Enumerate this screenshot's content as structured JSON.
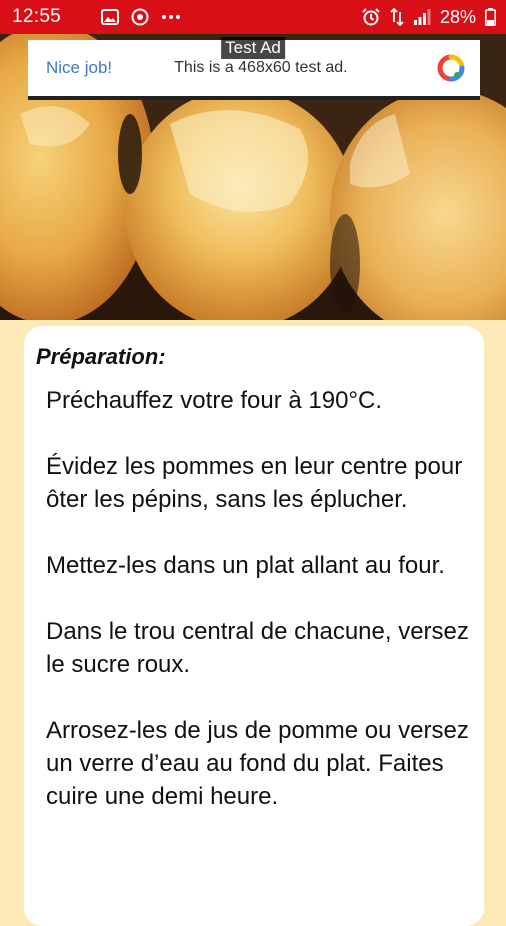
{
  "status_bar": {
    "time": "12:55",
    "battery_text": "28%",
    "background_color": "#d90f17",
    "left_icons": [
      "image-icon",
      "camera-icon",
      "more-dots-icon"
    ],
    "right_icons": [
      "alarm-icon",
      "network-4g-icon",
      "signal-icon",
      "battery-icon"
    ]
  },
  "ad": {
    "label": "Test Ad",
    "nice_text": "Nice job!",
    "body_text": "This is a 468x60 test ad.",
    "logo_icon": "ad-choices-logo-icon"
  },
  "content": {
    "title": "Préparation:",
    "steps": [
      "Préchauffez votre four à 190°C.",
      "Évidez les pommes en leur centre pour ôter les pépins, sans les éplucher.",
      "Mettez-les dans un plat allant au four.",
      "Dans le trou central de chacune, versez le sucre roux.",
      "Arrosez-les de jus de pomme ou versez un verre d’eau au fond du plat. Faites cuire une demi heure."
    ]
  },
  "colors": {
    "page_background": "#fde9b5",
    "card_background": "#ffffff",
    "ad_link": "#3c78c8"
  }
}
